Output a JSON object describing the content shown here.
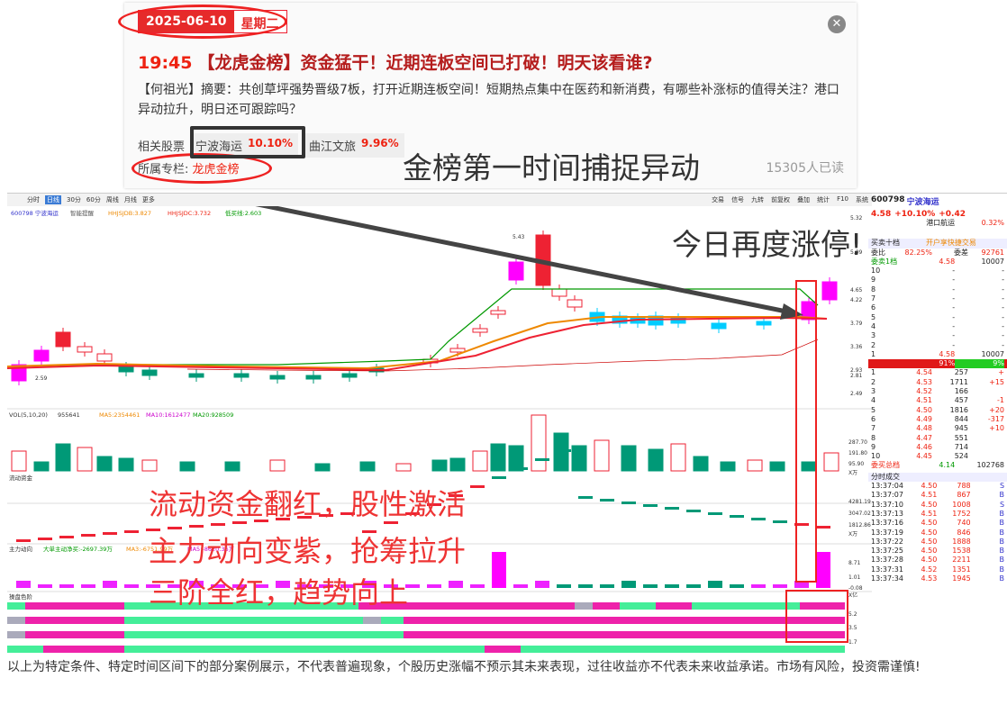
{
  "news": {
    "date": "2025-06-10",
    "weekday": "星期二",
    "time": "19:45",
    "title": "【龙虎金榜】资金猛干！近期连板空间已打破！明天该看谁?",
    "summary": "【何祖光】摘要：共创草坪强势晋级7板，打开近期连板空间！短期热点集中在医药和新消费，有哪些补涨标的值得关注？港口异动拉升，明日还可跟踪吗？",
    "related_label": "相关股票",
    "stocks": [
      {
        "name": "宁波海运",
        "change": "10.10%"
      },
      {
        "name": "曲江文旅",
        "change": "9.96%"
      }
    ],
    "column_label": "所属专栏:",
    "column_name": "龙虎金榜",
    "readers": "15305人已读",
    "close_icon": "close-icon"
  },
  "annotations": {
    "capture": "金榜第一时间捕捉异动",
    "limit_up": "今日再度涨停!",
    "flow": "流动资金翻红，股性激活",
    "main": "主力动向变紫，抢筹拉升",
    "three": "三阶全红，趋势向上"
  },
  "toolbar": {
    "items": [
      "分时",
      "日线",
      "30分",
      "60分",
      "周线",
      "月线",
      "更多"
    ],
    "active": "日线",
    "right": [
      "交易",
      "信号",
      "九转",
      "前复权",
      "叠加",
      "统计",
      "F10",
      "系统"
    ]
  },
  "main_legend": {
    "code": "600798 宁波海运",
    "ind": "智能提醒",
    "a": "HHJSJDB:3.827",
    "b": "HHJSJDC:3.732",
    "c": "低买线:2.603"
  },
  "vol_legend": {
    "name": "VOL(5,10,20)",
    "v": "955641",
    "ma5": "MA5:2354461",
    "ma10": "MA10:1612477",
    "ma20": "MA20:928509"
  },
  "flow_legend": "流动资金",
  "main_legend2": {
    "name": "主力动向",
    "a": "大单主动净买:-2697.39万",
    "b": "MA3:-6751.99万",
    "c": "MA5:-8620.36万",
    "d": "主力动向"
  },
  "stage_legend": "操盘色阶",
  "price_axis": [
    "5.32",
    "5.09",
    "4.65",
    "4.22",
    "3.79",
    "3.36",
    "2.93",
    "2.81",
    "2.49"
  ],
  "price_points": {
    "high": "5.43",
    "low": "2.59"
  },
  "vol_axis": [
    "287.70",
    "191.80",
    "95.90",
    "X万"
  ],
  "flow_axis": [
    "4281.19",
    "3047.02",
    "1812.86",
    "X万"
  ],
  "main_axis": [
    "8.71",
    "1.01",
    "-0.08",
    "X亿"
  ],
  "stage_axis": [
    "5.2",
    "3.5",
    "1.7"
  ],
  "chart_data": {
    "type": "candlestick",
    "stock": "600798 宁波海运",
    "last_close": 4.58
  },
  "side": {
    "code": "600798",
    "name": "宁波海运",
    "price": "4.58",
    "chg": "+10.10%",
    "diff": "+0.42",
    "tag1": "港口航运",
    "tag1v": "0.32%",
    "buy10": "买卖十档",
    "open": "开户享快捷交易",
    "wb": "委比",
    "wbv": "82.25%",
    "wc": "委差",
    "wcv": "92761",
    "sell1": "委卖1档",
    "s1p": "4.58",
    "s1v": "10007",
    "sells": [
      "10",
      "9",
      "8",
      "7",
      "6",
      "5",
      "4",
      "3",
      "2"
    ],
    "b1": {
      "l": "1",
      "p": "4.58",
      "v": "10007"
    },
    "ratio": {
      "l": "91%",
      "r": "9%"
    },
    "buys": [
      [
        "1",
        "4.54",
        "257",
        "+"
      ],
      [
        "2",
        "4.53",
        "1711",
        "+15"
      ],
      [
        "3",
        "4.52",
        "166",
        ""
      ],
      [
        "4",
        "4.51",
        "457",
        "-1"
      ],
      [
        "5",
        "4.50",
        "1816",
        "+20"
      ],
      [
        "6",
        "4.49",
        "844",
        "-317"
      ],
      [
        "7",
        "4.48",
        "945",
        "+10"
      ],
      [
        "8",
        "4.47",
        "551",
        ""
      ],
      [
        "9",
        "4.46",
        "714",
        ""
      ],
      [
        "10",
        "4.45",
        "524",
        ""
      ]
    ],
    "buytotal": {
      "l": "委买总档",
      "p": "4.14",
      "v": "102768"
    },
    "ticks_title": "分时成交",
    "ticks": [
      [
        "13:37:04",
        "4.50",
        "788",
        "S"
      ],
      [
        "13:37:07",
        "4.51",
        "867",
        "B"
      ],
      [
        "13:37:10",
        "4.50",
        "1008",
        "S"
      ],
      [
        "13:37:13",
        "4.51",
        "1752",
        "B"
      ],
      [
        "13:37:16",
        "4.50",
        "740",
        "B"
      ],
      [
        "13:37:19",
        "4.50",
        "846",
        "B"
      ],
      [
        "13:37:22",
        "4.50",
        "1888",
        "B"
      ],
      [
        "13:37:25",
        "4.50",
        "1538",
        "B"
      ],
      [
        "13:37:28",
        "4.50",
        "2211",
        "B"
      ],
      [
        "13:37:31",
        "4.52",
        "1351",
        "B"
      ],
      [
        "13:37:34",
        "4.53",
        "1945",
        "B"
      ]
    ]
  },
  "disclaimer": "以上为特定条件、特定时间区间下的部分案例展示，不代表普遍现象，个股历史涨幅不预示其未来表现，过往收益亦不代表未来收益承诺。市场有风险，投资需谨慎!"
}
